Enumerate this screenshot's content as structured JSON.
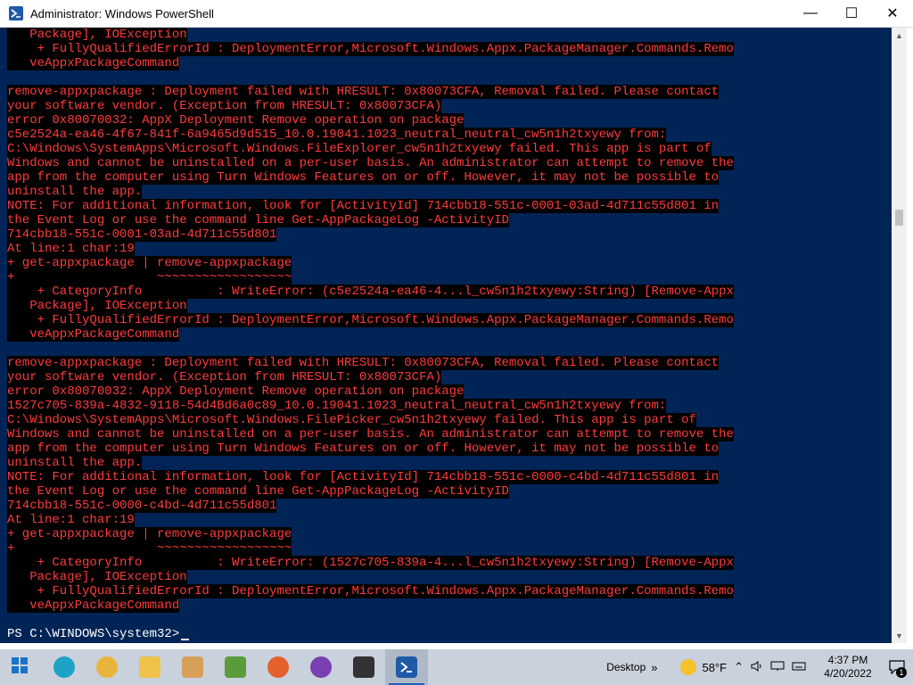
{
  "window": {
    "title": "Administrator: Windows PowerShell",
    "minimize_glyph": "—",
    "maximize_glyph": "☐",
    "close_glyph": "✕"
  },
  "console": {
    "error_lines": [
      "   Package], IOException",
      "    + FullyQualifiedErrorId : DeploymentError,Microsoft.Windows.Appx.PackageManager.Commands.Remo",
      "   veAppxPackageCommand",
      "",
      "remove-appxpackage : Deployment failed with HRESULT: 0x80073CFA, Removal failed. Please contact",
      "your software vendor. (Exception from HRESULT: 0x80073CFA)",
      "error 0x80070032: AppX Deployment Remove operation on package",
      "c5e2524a-ea46-4f67-841f-6a9465d9d515_10.0.19041.1023_neutral_neutral_cw5n1h2txyewy from:",
      "C:\\Windows\\SystemApps\\Microsoft.Windows.FileExplorer_cw5n1h2txyewy failed. This app is part of",
      "Windows and cannot be uninstalled on a per-user basis. An administrator can attempt to remove the",
      "app from the computer using Turn Windows Features on or off. However, it may not be possible to",
      "uninstall the app.",
      "NOTE: For additional information, look for [ActivityId] 714cbb18-551c-0001-03ad-4d711c55d801 in",
      "the Event Log or use the command line Get-AppPackageLog -ActivityID",
      "714cbb18-551c-0001-03ad-4d711c55d801",
      "At line:1 char:19",
      "+ get-appxpackage | remove-appxpackage",
      "+                   ~~~~~~~~~~~~~~~~~~",
      "    + CategoryInfo          : WriteError: (c5e2524a-ea46-4...l_cw5n1h2txyewy:String) [Remove-Appx",
      "   Package], IOException",
      "    + FullyQualifiedErrorId : DeploymentError,Microsoft.Windows.Appx.PackageManager.Commands.Remo",
      "   veAppxPackageCommand",
      "",
      "remove-appxpackage : Deployment failed with HRESULT: 0x80073CFA, Removal failed. Please contact",
      "your software vendor. (Exception from HRESULT: 0x80073CFA)",
      "error 0x80070032: AppX Deployment Remove operation on package",
      "1527c705-839a-4832-9118-54d4Bd6a0c89_10.0.19041.1023_neutral_neutral_cw5n1h2txyewy from:",
      "C:\\Windows\\SystemApps\\Microsoft.Windows.FilePicker_cw5n1h2txyewy failed. This app is part of",
      "Windows and cannot be uninstalled on a per-user basis. An administrator can attempt to remove the",
      "app from the computer using Turn Windows Features on or off. However, it may not be possible to",
      "uninstall the app.",
      "NOTE: For additional information, look for [ActivityId] 714cbb18-551c-0000-c4bd-4d711c55d801 in",
      "the Event Log or use the command line Get-AppPackageLog -ActivityID",
      "714cbb18-551c-0000-c4bd-4d711c55d801",
      "At line:1 char:19",
      "+ get-appxpackage | remove-appxpackage",
      "+                   ~~~~~~~~~~~~~~~~~~",
      "    + CategoryInfo          : WriteError: (1527c705-839a-4...l_cw5n1h2txyewy:String) [Remove-Appx",
      "   Package], IOException",
      "    + FullyQualifiedErrorId : DeploymentError,Microsoft.Windows.Appx.PackageManager.Commands.Remo",
      "   veAppxPackageCommand",
      ""
    ],
    "prompt": "PS C:\\WINDOWS\\system32>"
  },
  "colors": {
    "console_bg": "#012456",
    "error_fg": "#ff3b3b",
    "error_bg": "#000000"
  },
  "taskbar": {
    "apps": [
      {
        "name": "start-button",
        "icon": "windows-logo-icon",
        "color": "#1a73c9"
      },
      {
        "name": "edge",
        "icon": "edge-icon",
        "color": "#1ea3c7"
      },
      {
        "name": "chrome",
        "icon": "chrome-icon",
        "color": "#e8b43a"
      },
      {
        "name": "file-explorer",
        "icon": "folder-icon",
        "color": "#f0c24a"
      },
      {
        "name": "paint",
        "icon": "paint-icon",
        "color": "#d6a05a"
      },
      {
        "name": "photos",
        "icon": "photos-icon",
        "color": "#5a9b3c"
      },
      {
        "name": "firefox",
        "icon": "firefox-icon",
        "color": "#e5602c"
      },
      {
        "name": "recorder",
        "icon": "disc-icon",
        "color": "#7a3fb0"
      },
      {
        "name": "video-editor",
        "icon": "clapper-icon",
        "color": "#333333"
      },
      {
        "name": "powershell",
        "icon": "powershell-icon",
        "color": "#1e5aa8"
      }
    ],
    "desktop_label": "Desktop",
    "desktop_chevron": "»",
    "temperature": "58°F",
    "tray_caret": "⌃",
    "time": "4:37 PM",
    "date": "4/20/2022",
    "notification_count": "1"
  }
}
